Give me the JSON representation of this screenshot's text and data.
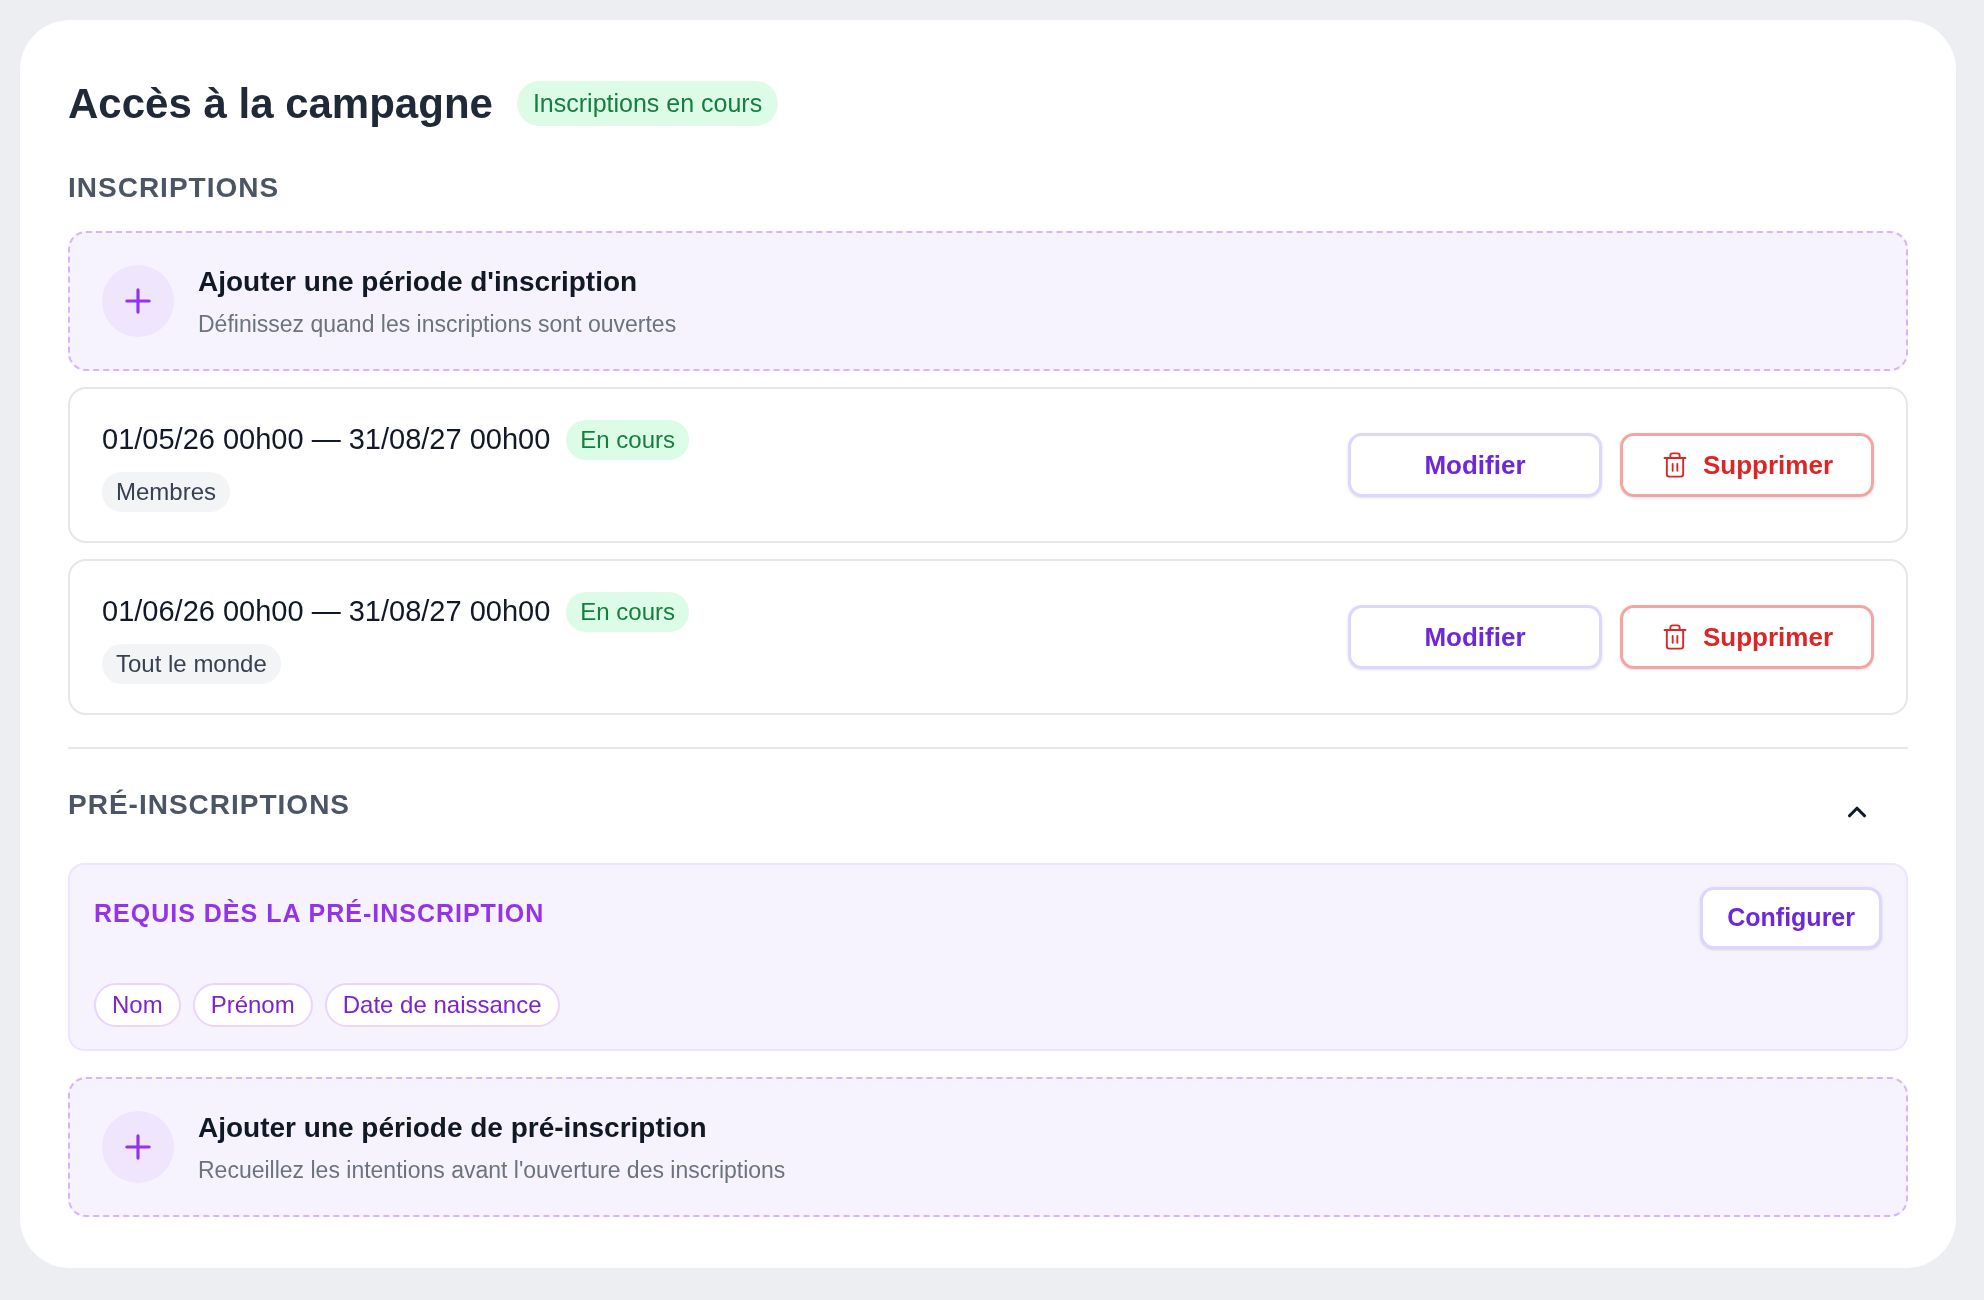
{
  "title": "Accès à la campagne",
  "status_badge": "Inscriptions en cours",
  "inscriptions": {
    "heading": "INSCRIPTIONS",
    "add": {
      "title": "Ajouter une période d'inscription",
      "subtitle": "Définissez quand les inscriptions sont ouvertes"
    },
    "periods": [
      {
        "range": "01/05/26 00h00 — 31/08/27 00h00",
        "status": "En cours",
        "audience": "Membres",
        "edit": "Modifier",
        "delete": "Supprimer"
      },
      {
        "range": "01/06/26 00h00 — 31/08/27 00h00",
        "status": "En cours",
        "audience": "Tout le monde",
        "edit": "Modifier",
        "delete": "Supprimer"
      }
    ]
  },
  "pre_inscriptions": {
    "heading": "PRÉ-INSCRIPTIONS",
    "expanded": true,
    "required": {
      "heading": "REQUIS DÈS LA PRÉ-INSCRIPTION",
      "configure": "Configurer",
      "fields": [
        "Nom",
        "Prénom",
        "Date de naissance"
      ]
    },
    "add": {
      "title": "Ajouter une période de pré-inscription",
      "subtitle": "Recueillez les intentions avant l'ouverture des inscriptions"
    }
  }
}
